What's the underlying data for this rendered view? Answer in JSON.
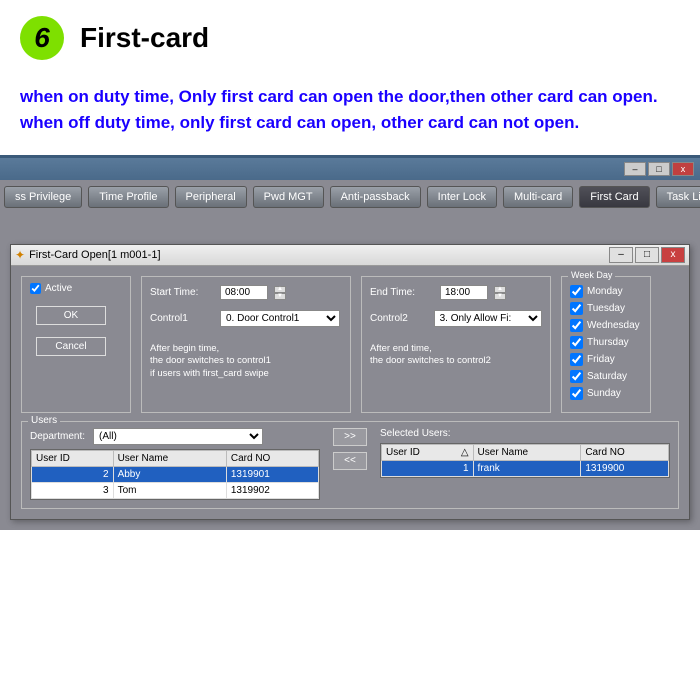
{
  "step": {
    "number": "6",
    "title": "First-card"
  },
  "desc": {
    "line1": "when on duty time, Only first card can open the door,then other card can open.",
    "line2": "when off duty time, only first card can open, other card can not open."
  },
  "tabs": [
    "ss Privilege",
    "Time Profile",
    "Peripheral",
    "Pwd MGT",
    "Anti-passback",
    "Inter Lock",
    "Multi-card",
    "First Card",
    "Task List"
  ],
  "active_tab": 7,
  "dlg": {
    "title": "First-Card Open[1   m001-1]",
    "active_label": "Active",
    "ok": "OK",
    "cancel": "Cancel",
    "start_label": "Start Time:",
    "start_val": "08:00",
    "ctl1_label": "Control1",
    "ctl1_val": "0. Door Control1",
    "note1a": "After begin time,",
    "note1b": "the door switches to control1",
    "note1c": "if users with first_card  swipe",
    "end_label": "End Time:",
    "end_val": "18:00",
    "ctl2_label": "Control2",
    "ctl2_val": "3. Only Allow Fi:",
    "note2a": "After end time,",
    "note2b": "the door switches to control2",
    "week_legend": "Week Day",
    "days": [
      "Monday",
      "Tuesday",
      "Wednesday",
      "Thursday",
      "Friday",
      "Saturday",
      "Sunday"
    ]
  },
  "users": {
    "legend": "Users",
    "dept_label": "Department:",
    "dept_val": "(All)",
    "sel_label": "Selected Users:",
    "cols": [
      "User ID",
      "User Name",
      "Card NO"
    ],
    "left_rows": [
      {
        "id": "2",
        "name": "Abby",
        "card": "1319901",
        "sel": true
      },
      {
        "id": "3",
        "name": "Tom",
        "card": "1319902",
        "sel": false
      }
    ],
    "right_rows": [
      {
        "id": "1",
        "name": "frank",
        "card": "1319900",
        "sel": true
      }
    ],
    "move_right": ">>",
    "move_left": "<<"
  }
}
